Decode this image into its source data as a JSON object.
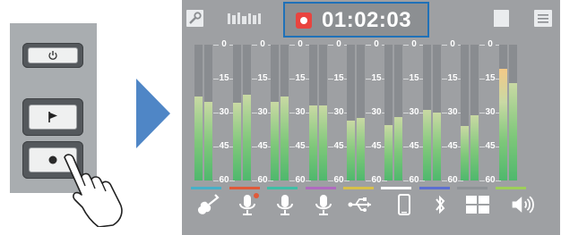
{
  "device": {
    "buttons": [
      {
        "name": "power-button",
        "icon": "power-icon"
      },
      {
        "name": "marker-button",
        "icon": "flag-icon"
      },
      {
        "name": "record-button",
        "icon": "record-dot-icon"
      }
    ]
  },
  "screen": {
    "topbar": {
      "left_icons": [
        "wrench-icon",
        "scene-name-text-garbled"
      ],
      "recording_indicator": "record-icon",
      "timer": "01:02:03",
      "right_icons": [
        "sd-card-icon",
        "menu-icon"
      ]
    },
    "meter_scale": [
      "0",
      "15",
      "30",
      "45",
      "60"
    ],
    "channels": [
      {
        "icon": "guitar-icon",
        "color": "#48b0c8",
        "levels": [
          0.62,
          0.58
        ]
      },
      {
        "icon": "mic-icon",
        "color": "#e05a3a",
        "levels": [
          0.57,
          0.63
        ]
      },
      {
        "icon": "mic-icon",
        "color": "#3fbfa6",
        "levels": [
          0.58,
          0.62
        ]
      },
      {
        "icon": "mic-icon",
        "color": "#b06ac0",
        "levels": [
          0.55,
          0.55
        ]
      },
      {
        "icon": "usb-icon",
        "color": "#d7c04a",
        "levels": [
          0.44,
          0.46
        ]
      },
      {
        "icon": "phone-icon",
        "color": "#ffffff",
        "levels": [
          0.41,
          0.47
        ]
      },
      {
        "icon": "bluetooth-icon",
        "color": "#5c6fd0",
        "levels": [
          0.52,
          0.5
        ]
      },
      {
        "icon": "grid-icon",
        "color": "#8e9296",
        "levels": [
          0.4,
          0.48
        ]
      },
      {
        "icon": "speaker-icon",
        "color": "#9ecf5a",
        "levels": [
          0.82,
          0.72
        ]
      }
    ]
  },
  "colors": {
    "accent": "#1f71b8",
    "record": "#e9443f",
    "arrow": "#4f86c6"
  }
}
